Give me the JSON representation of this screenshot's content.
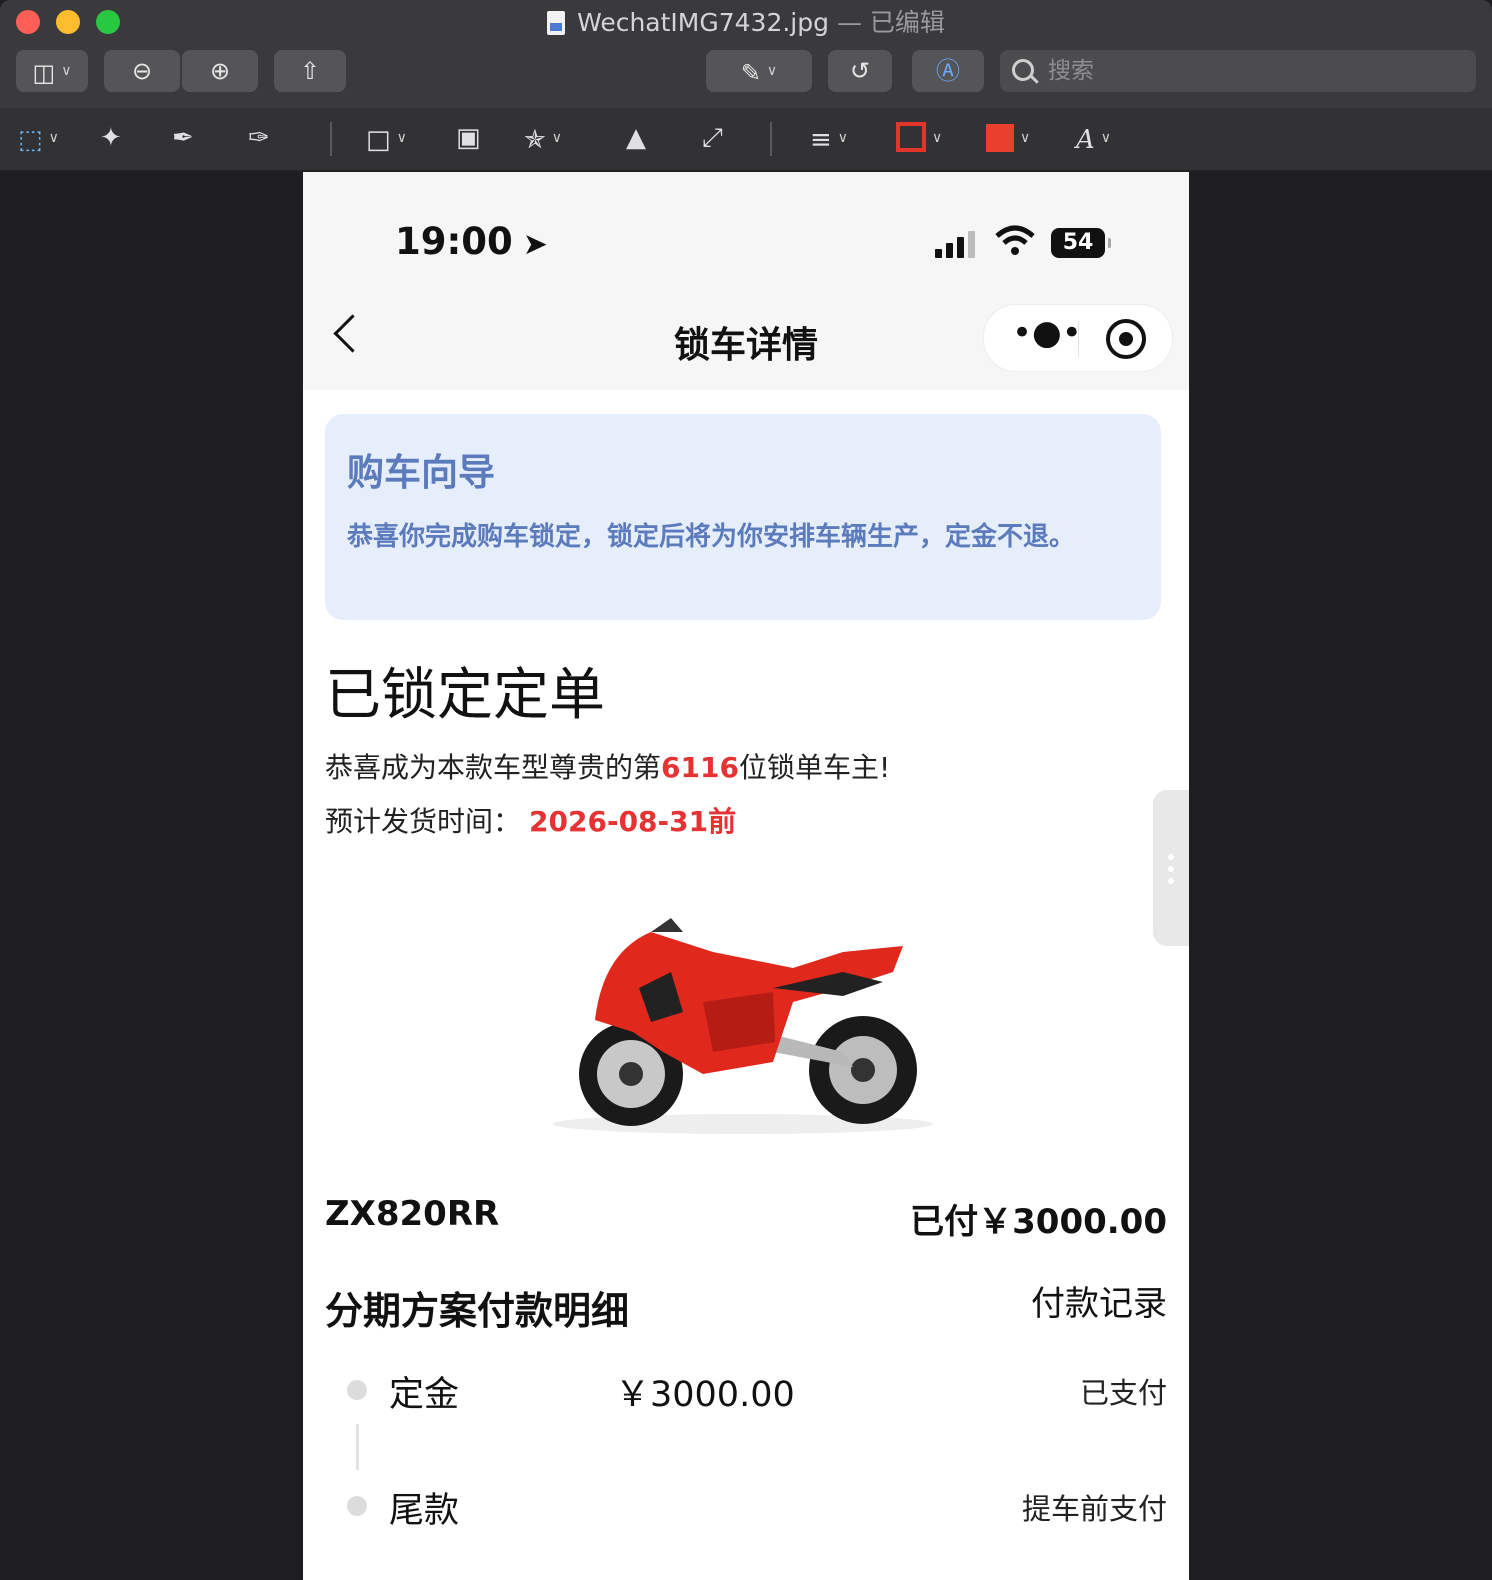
{
  "window": {
    "filename": "WechatIMG7432.jpg",
    "edited_suffix": " — 已编辑",
    "search_placeholder": "搜索",
    "icons": [
      "sidebar-icon",
      "zoom-out-icon",
      "zoom-in-icon",
      "share-icon",
      "markup-pen-icon",
      "rotate-icon",
      "annotate-icon",
      "search-icon"
    ],
    "markup_icons": [
      "rectangular-selection-icon",
      "instant-alpha-icon",
      "sketch-icon",
      "draw-icon",
      "shapes-icon",
      "text-box-icon",
      "signature-icon",
      "adjust-color-icon",
      "adjust-size-icon",
      "shape-style-icon",
      "border-color-icon",
      "fill-color-icon",
      "text-style-icon"
    ],
    "colors": {
      "border_color": "#e0362a",
      "fill_color": "#e8402c"
    }
  },
  "phone": {
    "status": {
      "time": "19:00",
      "battery": "54"
    },
    "nav": {
      "title": "锁车详情"
    },
    "guide": {
      "title": "购车向导",
      "text": "恭喜你完成购车锁定，锁定后将为你安排车辆生产，定金不退。"
    },
    "order": {
      "title": "已锁定定单",
      "congrats_prefix": "恭喜成为本款车型尊贵的第",
      "rank": "6116",
      "congrats_suffix": "位锁单车主!",
      "ship_label": "预计发货时间：",
      "ship_date": "2026-08-31前"
    },
    "vehicle": {
      "model": "ZX820RR",
      "paid": "已付￥3000.00"
    },
    "plan": {
      "title": "分期方案付款明细",
      "records_link": "付款记录",
      "rows": [
        {
          "label": "定金",
          "amount": "￥3000.00",
          "status": "已支付"
        },
        {
          "label": "尾款",
          "amount": "",
          "status": "提车前支付"
        }
      ]
    },
    "accent_red": "#e63232",
    "guide_blue": "#5b7bbd"
  }
}
